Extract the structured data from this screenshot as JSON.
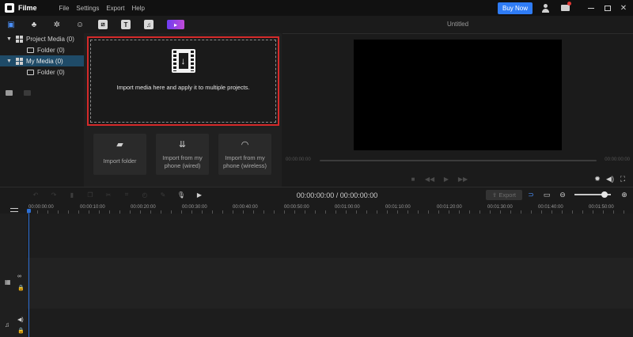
{
  "app": {
    "name": "Filme",
    "menu": [
      "File",
      "Settings",
      "Export",
      "Help"
    ],
    "buy_label": "Buy Now"
  },
  "toolbar": {
    "tools": [
      {
        "name": "media-icon",
        "glyph": "▣"
      },
      {
        "name": "audio-icon",
        "glyph": "♣"
      },
      {
        "name": "effects-icon",
        "glyph": "✲"
      },
      {
        "name": "sticker-icon",
        "glyph": "☺"
      },
      {
        "name": "transition-icon",
        "glyph": "⧄"
      },
      {
        "name": "text-icon",
        "glyph": "T"
      },
      {
        "name": "music-icon",
        "glyph": "♫"
      },
      {
        "name": "promo-icon",
        "glyph": "▸"
      }
    ]
  },
  "media_tree": {
    "project_media": "Project Media (0)",
    "project_folder": "Folder (0)",
    "my_media": "My Media (0)",
    "my_folder": "Folder (0)"
  },
  "drop_zone": {
    "text": "Import media here and apply it to multiple projects."
  },
  "import_cards": [
    {
      "name": "import-folder-button",
      "icon": "▰",
      "label": "Import folder"
    },
    {
      "name": "import-phone-wired-button",
      "icon": "⇊",
      "label": "Import from my phone (wired)"
    },
    {
      "name": "import-phone-wireless-button",
      "icon": "◠",
      "label": "Import from my phone (wireless)"
    }
  ],
  "preview": {
    "title": "Untitled",
    "time_left": "00:00:00:00",
    "time_right": "00:00:00:00"
  },
  "timeline": {
    "timecode": "00:00:00:00 / 00:00:00:00",
    "export_label": "Export",
    "ruler": [
      "00:00:00:00",
      "00:00:10:00",
      "00:00:20:00",
      "00:00:30:00",
      "00:00:40:00",
      "00:00:50:00",
      "00:01:00:00",
      "00:01:10:00",
      "00:01:20:00",
      "00:01:30:00",
      "00:01:40:00",
      "00:01:50:00"
    ]
  },
  "colors": {
    "accent": "#2f7cf6",
    "highlight_border": "#d42a2a",
    "selected_row": "#1f4b68"
  }
}
